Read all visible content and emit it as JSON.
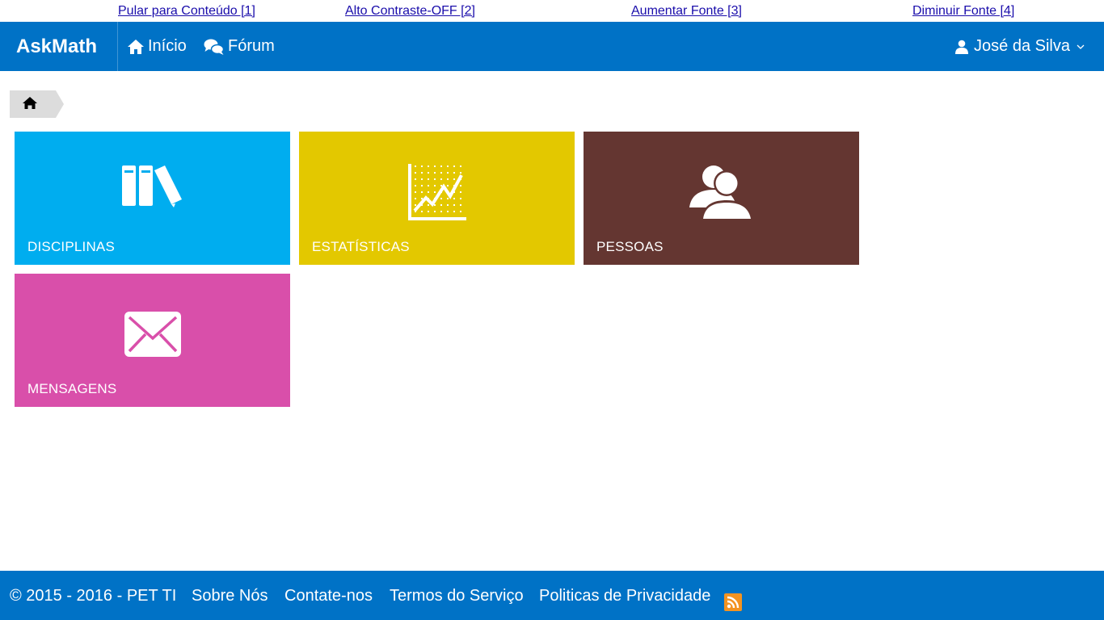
{
  "accessibility": {
    "skip_content": "Pular para Conteúdo [1]",
    "high_contrast": "Alto Contraste-OFF [2]",
    "increase_font": "Aumentar Fonte [3]",
    "decrease_font": "Diminuir Fonte [4]",
    "link_color": "#1a0dab"
  },
  "navbar": {
    "brand": "AskMath",
    "items": [
      {
        "label": "Início",
        "icon": "home-icon"
      },
      {
        "label": "Fórum",
        "icon": "chat-bubbles-icon"
      }
    ],
    "user": {
      "name": "José da Silva",
      "icon": "user-icon"
    },
    "color": "#0072c6"
  },
  "breadcrumb": {
    "icon": "home-icon"
  },
  "tiles": [
    {
      "label": "DISCIPLINAS",
      "icon": "books-icon",
      "color": "#00adef"
    },
    {
      "label": "ESTATÍSTICAS",
      "icon": "chart-icon",
      "color": "#e3c800"
    },
    {
      "label": "PESSOAS",
      "icon": "people-icon",
      "color": "#643631"
    },
    {
      "label": "MENSAGENS",
      "icon": "envelope-icon",
      "color": "#d94faa"
    }
  ],
  "footer": {
    "copyright": "© 2015 - 2016 - PET TI",
    "about": "Sobre Nós",
    "contact": "Contate-nos",
    "terms": "Termos do Serviço",
    "privacy": "Politicas de Privacidade",
    "rss_icon": "rss-icon"
  }
}
